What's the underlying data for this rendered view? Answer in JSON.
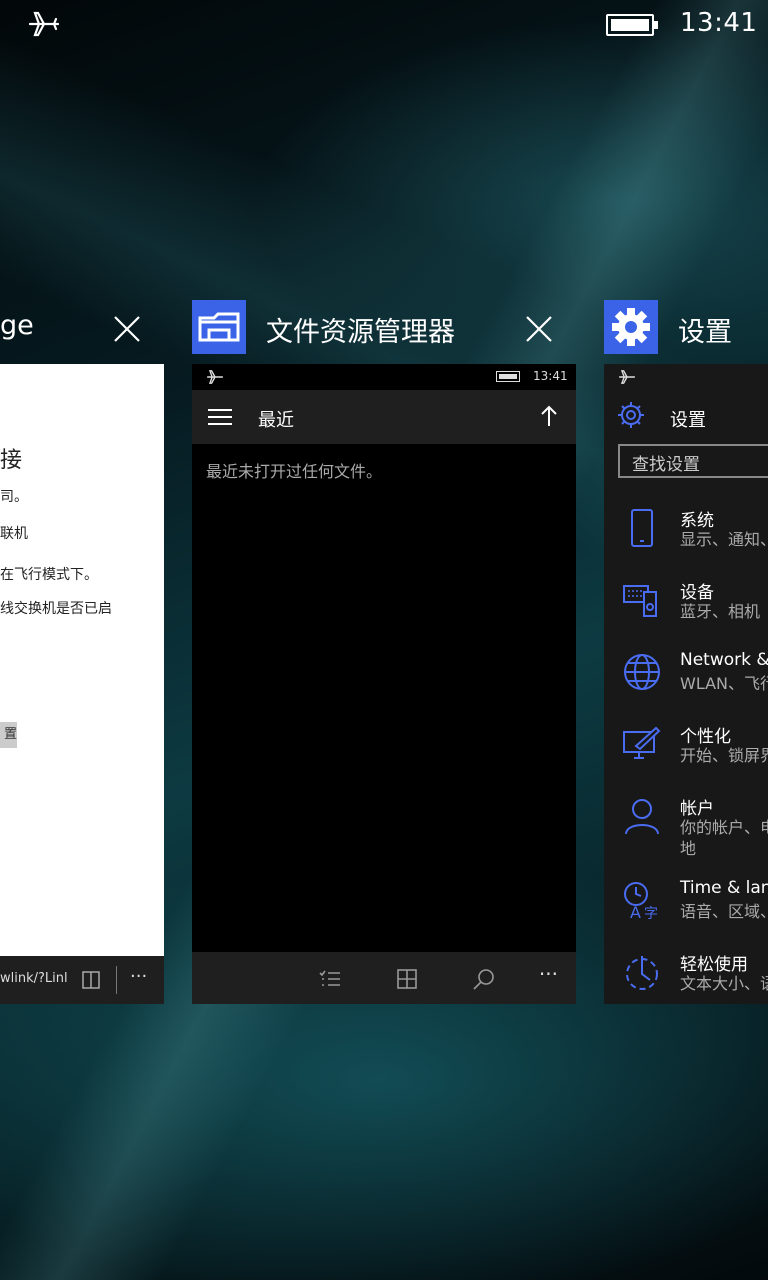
{
  "status": {
    "time": "13:41",
    "airplane_icon": "airplane-icon",
    "battery_icon": "battery-icon"
  },
  "cards": {
    "edge": {
      "title": "ge",
      "lines": [
        "接",
        "司。",
        "联机",
        "在飞行模式下。",
        "线交换机是否已启"
      ],
      "button": "置",
      "url": "wlink/?Linl",
      "more": "···"
    },
    "files": {
      "title": "文件资源管理器",
      "status_time": "13:41",
      "header_title": "最近",
      "empty_message": "最近未打开过任何文件。",
      "more": "···"
    },
    "settings": {
      "title": "设置",
      "header_title": "设置",
      "search_placeholder": "查找设置",
      "items": [
        {
          "name": "系统",
          "desc": "显示、通知、"
        },
        {
          "name": "设备",
          "desc": "蓝牙、相机"
        },
        {
          "name": "Network &",
          "desc": "WLAN、飞行"
        },
        {
          "name": "个性化",
          "desc": "开始、锁屏界"
        },
        {
          "name": "帐户",
          "desc": "你的帐户、电",
          "desc2": "地"
        },
        {
          "name": "Time & lan",
          "desc": "语音、区域、"
        },
        {
          "name": "轻松使用",
          "desc": "文本大小、语"
        }
      ]
    }
  },
  "colors": {
    "accent": "#3a63e8",
    "card_header_bg": "#1f1f1f"
  }
}
